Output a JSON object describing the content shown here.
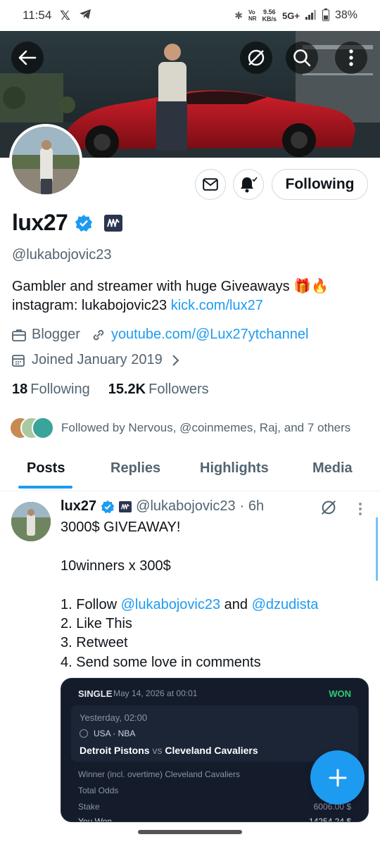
{
  "status_bar": {
    "time": "11:54",
    "net_speed": "9.56",
    "net_unit": "KB/s",
    "vo": "Vo",
    "nr": "NR",
    "network": "5G+",
    "battery": "38%"
  },
  "profile": {
    "display_name": "lux27",
    "handle": "@lukabojovic23",
    "bio_line1": "Gambler and streamer with huge Giveaways 🎁🔥",
    "bio_line2_prefix": "instagram: lukabojovic23 ",
    "bio_link": "kick.com/lux27",
    "category": "Blogger",
    "website": "youtube.com/@Lux27ytchannel",
    "joined": "Joined January 2019",
    "following_count": "18",
    "following_label": "Following",
    "followers_count": "15.2K",
    "followers_label": "Followers",
    "followed_by": "Followed by Nervous, @coinmemes, Raj, and 7 others",
    "follow_button": "Following"
  },
  "tabs": [
    {
      "label": "Posts",
      "active": true
    },
    {
      "label": "Replies",
      "active": false
    },
    {
      "label": "Highlights",
      "active": false
    },
    {
      "label": "Media",
      "active": false
    }
  ],
  "tweet": {
    "name": "lux27",
    "handle": "@lukabojovic23",
    "time": "· 6h",
    "line1": "3000$ GIVEAWAY!",
    "line2": "10winners x 300$",
    "step1_prefix": "1. Follow ",
    "step1_mention1": "@lukabojovic23",
    "step1_and": " and ",
    "step1_mention2": "@dzudista",
    "step2": "2. Like This",
    "step3": "3. Retweet",
    "step4": "4. Send some love in comments"
  },
  "bet_slip": {
    "type": "SINGLE",
    "date": "May 14, 2026 at 00:01",
    "status": "WON",
    "event_time": "Yesterday, 02:00",
    "league": "USA · NBA",
    "team1": "Detroit Pistons",
    "vs": "vs",
    "team2": "Cleveland Cavaliers",
    "market": "Winner (incl. overtime) Cleveland Cavaliers",
    "total_odds_label": "Total Odds",
    "stake_label": "Stake",
    "stake_value": "6006.00 $",
    "win_label": "You Won",
    "win_value": "14254.24 $"
  },
  "colors": {
    "accent": "#1d9bf0",
    "text": "#0f1419",
    "secondary": "#536471",
    "won": "#2ecc71"
  },
  "icons": [
    "back-arrow-icon",
    "grok-icon",
    "search-icon",
    "more-vertical-icon",
    "mail-icon",
    "bell-icon",
    "verified-icon",
    "briefcase-icon",
    "link-icon",
    "calendar-icon",
    "chevron-right-icon",
    "plus-icon"
  ]
}
